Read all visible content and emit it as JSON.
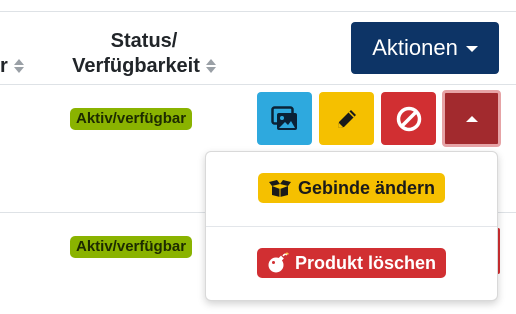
{
  "table": {
    "prev_column_fragment": "r",
    "status_header_line1": "Status/",
    "status_header_line2": "Verfügbarkeit",
    "actions_button_label": "Aktionen"
  },
  "rows": [
    {
      "status_badge": "Aktiv/verfügbar"
    },
    {
      "status_badge": "Aktiv/verfügbar"
    }
  ],
  "row_actions": {
    "icons": [
      "images-icon",
      "pencil-icon",
      "ban-icon",
      "caret-up-icon"
    ]
  },
  "dropdown": {
    "items": [
      {
        "label": "Gebinde ändern",
        "icon": "box-open-icon"
      },
      {
        "label": "Produkt löschen",
        "icon": "bomb-icon"
      }
    ]
  },
  "colors": {
    "primary_navy": "#0d3466",
    "status_green": "#8ab300",
    "info_blue": "#2ea9de",
    "warning_yellow": "#f5c000",
    "danger_red": "#d12f32",
    "danger_dark": "#a22a2e"
  }
}
